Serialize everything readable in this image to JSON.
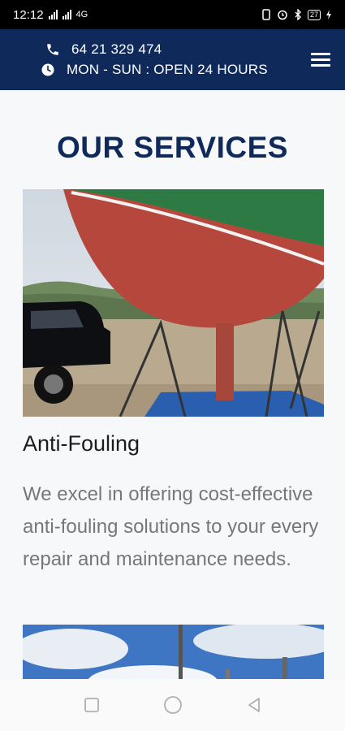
{
  "status_bar": {
    "time": "12:12",
    "network_label": "4G",
    "battery_level": "27"
  },
  "header": {
    "phone": "64 21 329 474",
    "hours": "MON - SUN : OPEN 24 HOURS",
    "icons": [
      "phone-icon",
      "clock-icon",
      "menu-icon"
    ]
  },
  "main": {
    "section_title": "OUR SERVICES",
    "services": [
      {
        "title": "Anti-Fouling",
        "description": "We excel in offering cost-effective anti-fouling solutions to your every repair and maintenance needs."
      }
    ]
  },
  "nav_bar": {
    "buttons": [
      "recent-apps",
      "home",
      "back"
    ]
  },
  "colors": {
    "header_bg": "#0f2a5a",
    "title_color": "#0f2a5a",
    "description_color": "#777777",
    "content_bg": "#f7f8fa"
  }
}
